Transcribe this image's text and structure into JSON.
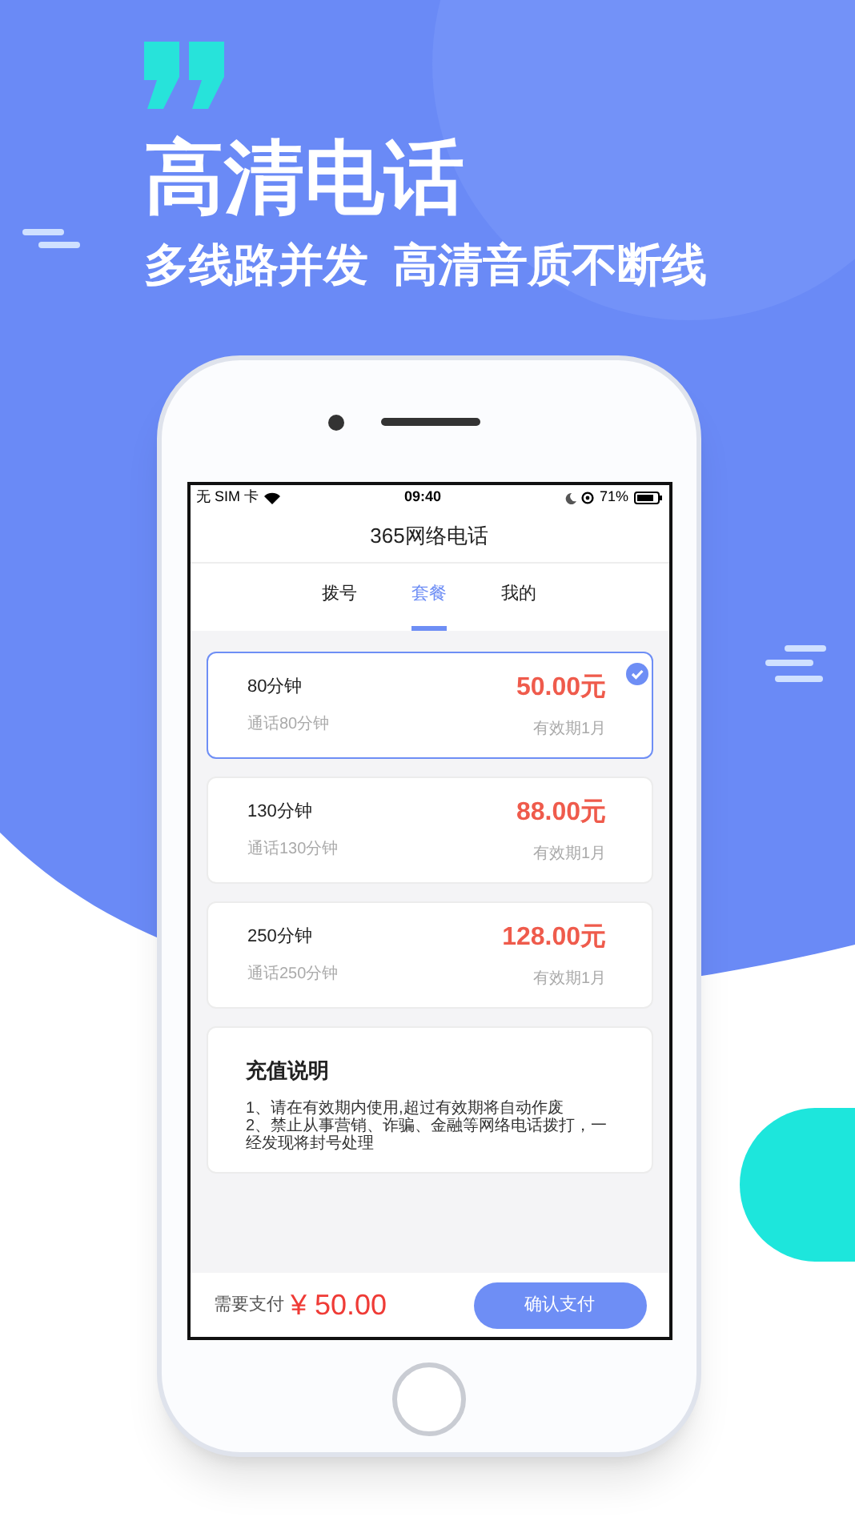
{
  "hero": {
    "title": "高清电话",
    "subtitle": "多线路并发  高清音质不断线"
  },
  "status_bar": {
    "carrier": "无 SIM 卡",
    "time": "09:40",
    "battery": "71%"
  },
  "app_title": "365网络电话",
  "tabs": [
    {
      "label": "拨号",
      "selected": false
    },
    {
      "label": "套餐",
      "selected": true
    },
    {
      "label": "我的",
      "selected": false
    }
  ],
  "plans": [
    {
      "name": "80分钟",
      "desc": "通话80分钟",
      "price": "50.00元",
      "validity": "有效期1月",
      "selected": true
    },
    {
      "name": "130分钟",
      "desc": "通话130分钟",
      "price": "88.00元",
      "validity": "有效期1月",
      "selected": false
    },
    {
      "name": "250分钟",
      "desc": "通话250分钟",
      "price": "128.00元",
      "validity": "有效期1月",
      "selected": false
    }
  ],
  "notice": {
    "title": "充值说明",
    "lines": [
      "1、请在有效期内使用,超过有效期将自动作废",
      "2、禁止从事营销、诈骗、金融等网络电话拨打，一经发现将封号处理"
    ]
  },
  "footer": {
    "label": "需要支付",
    "amount": "¥ 50.00",
    "button": "确认支付"
  }
}
